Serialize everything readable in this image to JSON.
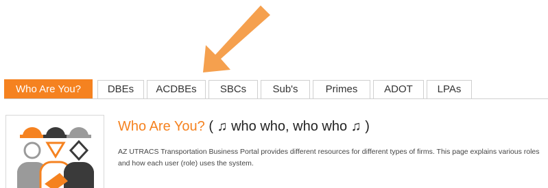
{
  "tabs": [
    {
      "label": "Who Are You?",
      "active": true
    },
    {
      "label": "DBEs",
      "active": false
    },
    {
      "label": "ACDBEs",
      "active": false
    },
    {
      "label": "SBCs",
      "active": false
    },
    {
      "label": "Sub's",
      "active": false
    },
    {
      "label": "Primes",
      "active": false
    },
    {
      "label": "ADOT",
      "active": false
    },
    {
      "label": "LPAs",
      "active": false
    }
  ],
  "content": {
    "title": "Who Are You?",
    "title_suffix": "( ♫ who who, who who ♫ )",
    "description": "AZ UTRACS Transportation Business Portal provides different resources for different types of firms. This page explains various roles and how each user (role) uses the system."
  },
  "colors": {
    "accent": "#f58220",
    "arrow": "#f5a04e",
    "tab_border": "#cfcfcf",
    "figure_gray": "#9a9a9a",
    "figure_dark": "#3a3a3a"
  },
  "icons": {
    "pointer": "arrow-pointer-icon",
    "roles": "construction-workers-icon"
  }
}
